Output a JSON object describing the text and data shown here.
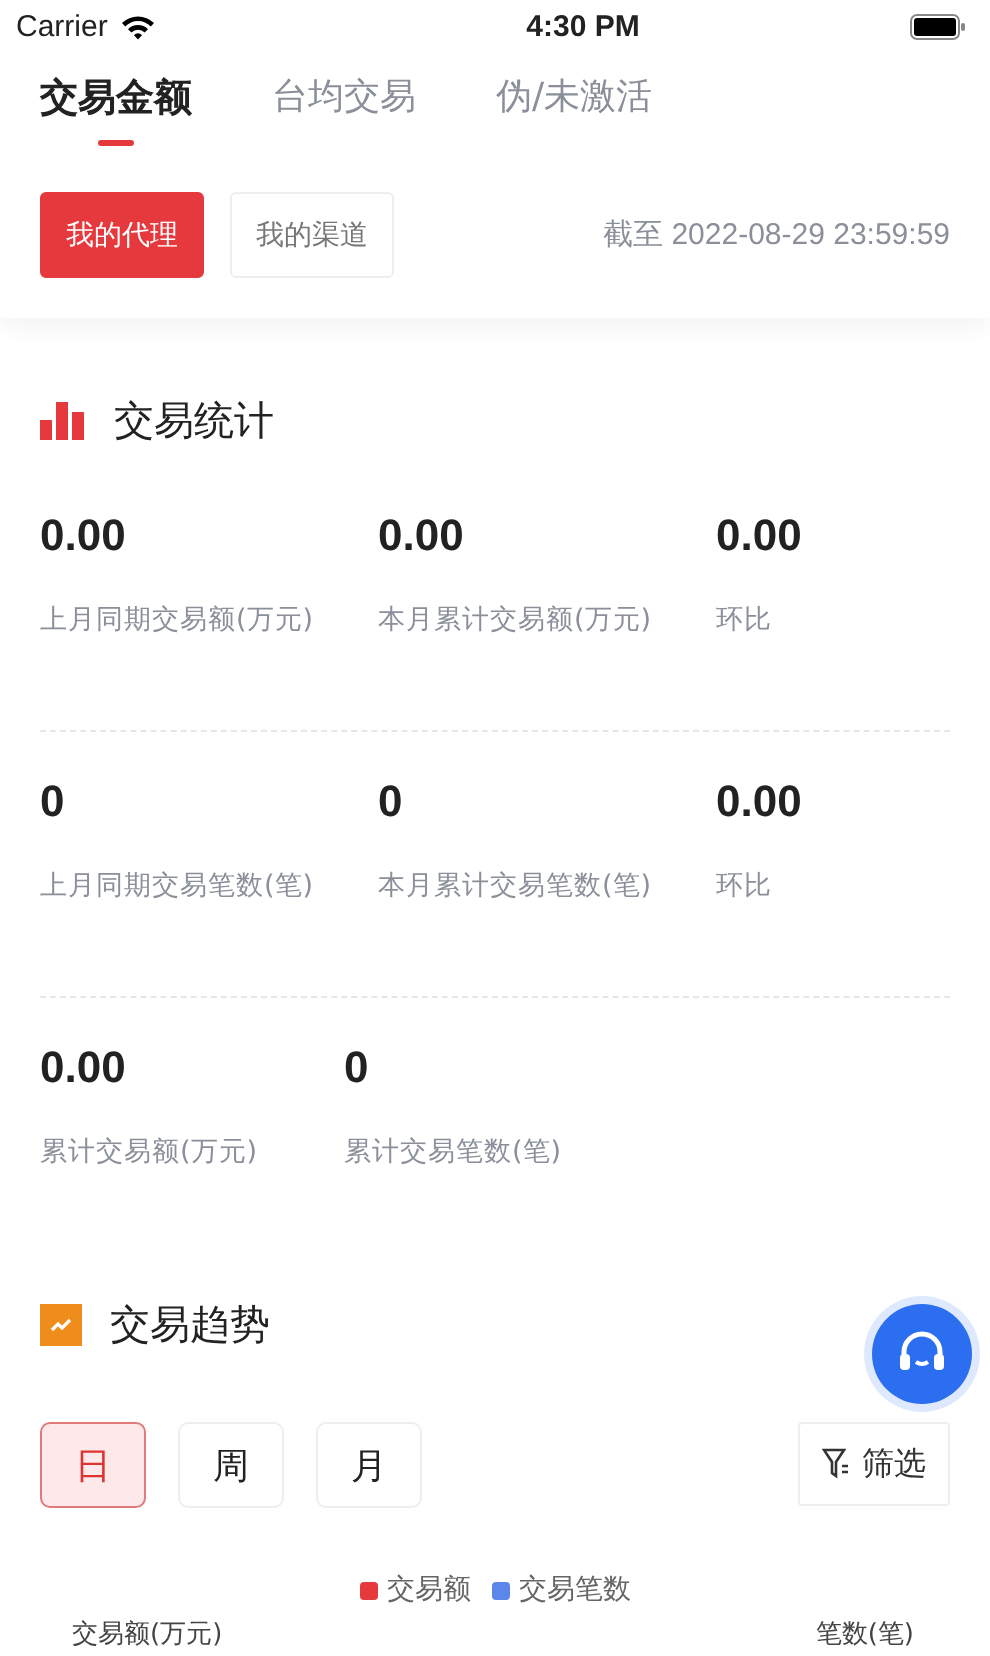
{
  "status_bar": {
    "carrier": "Carrier",
    "time": "4:30 PM"
  },
  "tabs": [
    {
      "label": "交易金额",
      "selected": true
    },
    {
      "label": "台均交易",
      "selected": false
    },
    {
      "label": "伪/未激活",
      "selected": false
    }
  ],
  "scope_buttons": [
    {
      "label": "我的代理",
      "selected": true
    },
    {
      "label": "我的渠道",
      "selected": false
    }
  ],
  "as_of": "截至 2022-08-29 23:59:59",
  "stats": {
    "title": "交易统计",
    "rows": [
      [
        {
          "value": "0.00",
          "label": "上月同期交易额(万元)"
        },
        {
          "value": "0.00",
          "label": "本月累计交易额(万元)"
        },
        {
          "value": "0.00",
          "label": "环比"
        }
      ],
      [
        {
          "value": "0",
          "label": "上月同期交易笔数(笔)"
        },
        {
          "value": "0",
          "label": "本月累计交易笔数(笔)"
        },
        {
          "value": "0.00",
          "label": "环比"
        }
      ],
      [
        {
          "value": "0.00",
          "label": "累计交易额(万元)"
        },
        {
          "value": "0",
          "label": "累计交易笔数(笔)"
        }
      ]
    ]
  },
  "trend": {
    "title": "交易趋势",
    "periods": [
      {
        "label": "日",
        "selected": true
      },
      {
        "label": "周",
        "selected": false
      },
      {
        "label": "月",
        "selected": false
      }
    ],
    "filter": "筛选",
    "legend": [
      {
        "label": "交易额",
        "color": "#e5393d"
      },
      {
        "label": "交易笔数",
        "color": "#5b86ea"
      }
    ],
    "left_axis_label": "交易额(万元)",
    "right_axis_label": "笔数(笔)"
  }
}
